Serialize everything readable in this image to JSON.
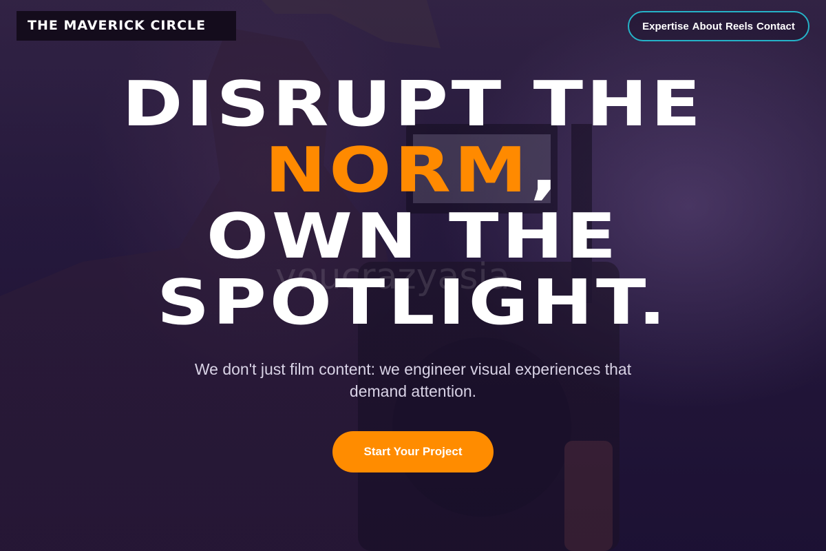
{
  "brand": {
    "name": "THE MAVERICK CIRCLE"
  },
  "nav": {
    "items": [
      {
        "label": "Expertise"
      },
      {
        "label": "About"
      },
      {
        "label": "Reels"
      },
      {
        "label": "Contact"
      }
    ]
  },
  "hero": {
    "headline": {
      "line1": "DISRUPT THE",
      "accent": "NORM",
      "comma": ",",
      "line3": "OWN THE",
      "line4": "SPOTLIGHT."
    },
    "subtitle": "We don't just film content: we engineer visual experiences that demand attention.",
    "cta_label": "Start Your Project",
    "watermark": "youcrazyasia",
    "background_image": "camera-operator-photo"
  },
  "colors": {
    "accent": "#ff8c00",
    "nav_border": "#25b3c8",
    "background": "#1d1233",
    "text": "#ffffff"
  }
}
